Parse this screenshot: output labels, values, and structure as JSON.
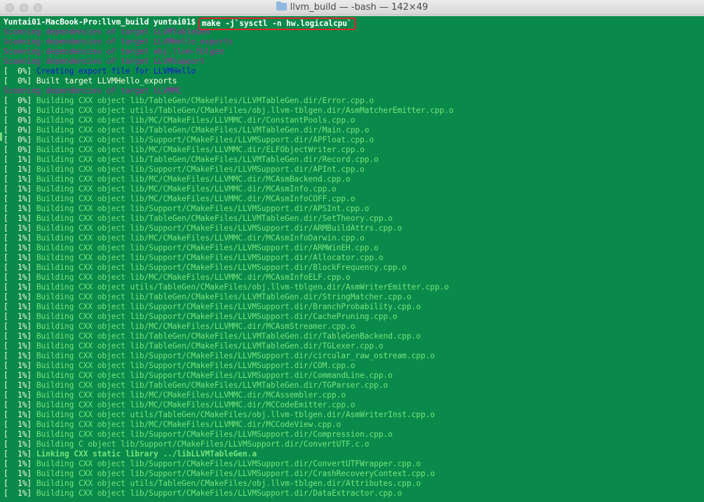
{
  "window": {
    "title": "llvm_build — -bash — 142×49",
    "colors": {
      "background": "#0a8a4a",
      "prompt": "#ffffff",
      "scan": "#a62aa1",
      "blue": "#1a12d8",
      "build": "#75e57e",
      "highlight": "#e0262f"
    }
  },
  "prompt": "Yuntai01-MacBook-Pro:llvm_build yuntai01$ ",
  "command": "make -j`sysctl -n hw.logicalcpu`",
  "lines": [
    {
      "text": "Scanning dependencies of target LLVMTableGen",
      "style": "scan"
    },
    {
      "text": "Scanning dependencies of target LLVMHello_exports",
      "style": "scan"
    },
    {
      "text": "Scanning dependencies of target obj.llvm-tblgen",
      "style": "scan"
    },
    {
      "text": "Scanning dependencies of target LLVMSupport",
      "style": "scan"
    },
    {
      "pct": "[  0%] ",
      "text": "Creating export file for LLVMHello",
      "style": "blue"
    },
    {
      "pct": "[  0%] ",
      "text": "Built target LLVMHello_exports",
      "style": "white"
    },
    {
      "text": "Scanning dependencies of target LLVMMC",
      "style": "scan"
    },
    {
      "pct": "[  0%] ",
      "text": "Building CXX object lib/TableGen/CMakeFiles/LLVMTableGen.dir/Error.cpp.o",
      "style": "build"
    },
    {
      "pct": "[  0%] ",
      "text": "Building CXX object utils/TableGen/CMakeFiles/obj.llvm-tblgen.dir/AsmMatcherEmitter.cpp.o",
      "style": "build"
    },
    {
      "pct": "[  0%] ",
      "text": "Building CXX object lib/MC/CMakeFiles/LLVMMC.dir/ConstantPools.cpp.o",
      "style": "build"
    },
    {
      "pct": "[  0%] ",
      "text": "Building CXX object lib/TableGen/CMakeFiles/LLVMTableGen.dir/Main.cpp.o",
      "style": "build"
    },
    {
      "pct": "[  0%] ",
      "text": "Building CXX object lib/Support/CMakeFiles/LLVMSupport.dir/APFloat.cpp.o",
      "style": "build"
    },
    {
      "pct": "[  0%] ",
      "text": "Building CXX object lib/MC/CMakeFiles/LLVMMC.dir/ELFObjectWriter.cpp.o",
      "style": "build"
    },
    {
      "pct": "[  1%] ",
      "text": "Building CXX object lib/TableGen/CMakeFiles/LLVMTableGen.dir/Record.cpp.o",
      "style": "build"
    },
    {
      "pct": "[  1%] ",
      "text": "Building CXX object lib/Support/CMakeFiles/LLVMSupport.dir/APInt.cpp.o",
      "style": "build"
    },
    {
      "pct": "[  1%] ",
      "text": "Building CXX object lib/MC/CMakeFiles/LLVMMC.dir/MCAsmBackend.cpp.o",
      "style": "build"
    },
    {
      "pct": "[  1%] ",
      "text": "Building CXX object lib/MC/CMakeFiles/LLVMMC.dir/MCAsmInfo.cpp.o",
      "style": "build"
    },
    {
      "pct": "[  1%] ",
      "text": "Building CXX object lib/MC/CMakeFiles/LLVMMC.dir/MCAsmInfoCOFF.cpp.o",
      "style": "build"
    },
    {
      "pct": "[  1%] ",
      "text": "Building CXX object lib/Support/CMakeFiles/LLVMSupport.dir/APSInt.cpp.o",
      "style": "build"
    },
    {
      "pct": "[  1%] ",
      "text": "Building CXX object lib/TableGen/CMakeFiles/LLVMTableGen.dir/SetTheory.cpp.o",
      "style": "build"
    },
    {
      "pct": "[  1%] ",
      "text": "Building CXX object lib/Support/CMakeFiles/LLVMSupport.dir/ARMBuildAttrs.cpp.o",
      "style": "build"
    },
    {
      "pct": "[  1%] ",
      "text": "Building CXX object lib/MC/CMakeFiles/LLVMMC.dir/MCAsmInfoDarwin.cpp.o",
      "style": "build"
    },
    {
      "pct": "[  1%] ",
      "text": "Building CXX object lib/Support/CMakeFiles/LLVMSupport.dir/ARMWinEH.cpp.o",
      "style": "build"
    },
    {
      "pct": "[  1%] ",
      "text": "Building CXX object lib/Support/CMakeFiles/LLVMSupport.dir/Allocator.cpp.o",
      "style": "build"
    },
    {
      "pct": "[  1%] ",
      "text": "Building CXX object lib/Support/CMakeFiles/LLVMSupport.dir/BlockFrequency.cpp.o",
      "style": "build"
    },
    {
      "pct": "[  1%] ",
      "text": "Building CXX object lib/MC/CMakeFiles/LLVMMC.dir/MCAsmInfoELF.cpp.o",
      "style": "build"
    },
    {
      "pct": "[  1%] ",
      "text": "Building CXX object utils/TableGen/CMakeFiles/obj.llvm-tblgen.dir/AsmWriterEmitter.cpp.o",
      "style": "build"
    },
    {
      "pct": "[  1%] ",
      "text": "Building CXX object lib/TableGen/CMakeFiles/LLVMTableGen.dir/StringMatcher.cpp.o",
      "style": "build"
    },
    {
      "pct": "[  1%] ",
      "text": "Building CXX object lib/Support/CMakeFiles/LLVMSupport.dir/BranchProbability.cpp.o",
      "style": "build"
    },
    {
      "pct": "[  1%] ",
      "text": "Building CXX object lib/Support/CMakeFiles/LLVMSupport.dir/CachePruning.cpp.o",
      "style": "build"
    },
    {
      "pct": "[  1%] ",
      "text": "Building CXX object lib/MC/CMakeFiles/LLVMMC.dir/MCAsmStreamer.cpp.o",
      "style": "build"
    },
    {
      "pct": "[  1%] ",
      "text": "Building CXX object lib/TableGen/CMakeFiles/LLVMTableGen.dir/TableGenBackend.cpp.o",
      "style": "build"
    },
    {
      "pct": "[  1%] ",
      "text": "Building CXX object lib/TableGen/CMakeFiles/LLVMTableGen.dir/TGLexer.cpp.o",
      "style": "build"
    },
    {
      "pct": "[  1%] ",
      "text": "Building CXX object lib/Support/CMakeFiles/LLVMSupport.dir/circular_raw_ostream.cpp.o",
      "style": "build"
    },
    {
      "pct": "[  1%] ",
      "text": "Building CXX object lib/Support/CMakeFiles/LLVMSupport.dir/COM.cpp.o",
      "style": "build"
    },
    {
      "pct": "[  1%] ",
      "text": "Building CXX object lib/Support/CMakeFiles/LLVMSupport.dir/CommandLine.cpp.o",
      "style": "build"
    },
    {
      "pct": "[  1%] ",
      "text": "Building CXX object lib/TableGen/CMakeFiles/LLVMTableGen.dir/TGParser.cpp.o",
      "style": "build"
    },
    {
      "pct": "[  1%] ",
      "text": "Building CXX object lib/MC/CMakeFiles/LLVMMC.dir/MCAssembler.cpp.o",
      "style": "build"
    },
    {
      "pct": "[  1%] ",
      "text": "Building CXX object lib/MC/CMakeFiles/LLVMMC.dir/MCCodeEmitter.cpp.o",
      "style": "build"
    },
    {
      "pct": "[  1%] ",
      "text": "Building CXX object utils/TableGen/CMakeFiles/obj.llvm-tblgen.dir/AsmWriterInst.cpp.o",
      "style": "build"
    },
    {
      "pct": "[  1%] ",
      "text": "Building CXX object lib/MC/CMakeFiles/LLVMMC.dir/MCCodeView.cpp.o",
      "style": "build"
    },
    {
      "pct": "[  1%] ",
      "text": "Building CXX object lib/Support/CMakeFiles/LLVMSupport.dir/Compression.cpp.o",
      "style": "build"
    },
    {
      "pct": "[  1%] ",
      "text": "Building C object lib/Support/CMakeFiles/LLVMSupport.dir/ConvertUTF.c.o",
      "style": "build"
    },
    {
      "pct": "[  1%] ",
      "text": "Linking CXX static library ../libLLVMTableGen.a",
      "style": "build bold"
    },
    {
      "pct": "[  1%] ",
      "text": "Building CXX object lib/Support/CMakeFiles/LLVMSupport.dir/ConvertUTFWrapper.cpp.o",
      "style": "build"
    },
    {
      "pct": "[  1%] ",
      "text": "Building CXX object lib/Support/CMakeFiles/LLVMSupport.dir/CrashRecoveryContext.cpp.o",
      "style": "build"
    },
    {
      "pct": "[  1%] ",
      "text": "Building CXX object utils/TableGen/CMakeFiles/obj.llvm-tblgen.dir/Attributes.cpp.o",
      "style": "build"
    },
    {
      "pct": "[  1%] ",
      "text": "Building CXX object lib/Support/CMakeFiles/LLVMSupport.dir/DataExtractor.cpp.o",
      "style": "build"
    }
  ]
}
